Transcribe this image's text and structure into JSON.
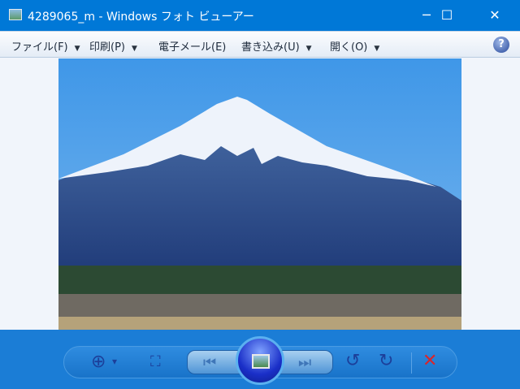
{
  "window": {
    "title": "4289065_m - Windows フォト ビューアー",
    "minimize": "─",
    "maximize": "☐",
    "close": "✕"
  },
  "menu": [
    {
      "label": "ファイル(F)",
      "dropdown": true
    },
    {
      "label": "印刷(P)",
      "dropdown": true
    },
    {
      "label": "電子メール(E)",
      "dropdown": false
    },
    {
      "label": "書き込み(U)",
      "dropdown": true
    },
    {
      "label": "開く(O)",
      "dropdown": true
    }
  ],
  "help": "?",
  "toolbar": {
    "zoom": "⊕",
    "zoom_arrow": "▾",
    "fit": "⛶",
    "prev": "⏮",
    "next": "⏭",
    "rotate_ccw": "↺",
    "rotate_cw": "↻",
    "delete": "✕"
  },
  "colors": {
    "titlebar": "#0078d7",
    "toolbar": "#1b7dd6",
    "delete": "#d8262c"
  }
}
